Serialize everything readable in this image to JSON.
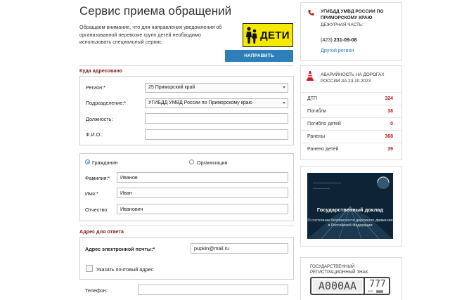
{
  "page_title": "Сервис приема обращений",
  "intro_text": "Обращаем внимание, что для направления уведомления об организованной перевозке групп детей необходимо использовать специальный сервис",
  "deti_logo": "ДЕТИ",
  "notify_button": "НАПРАВИТЬ УВЕДОМЛЕНИЕ",
  "address_section": {
    "title": "Куда адресовано",
    "region_label": "Регион:*",
    "region_value": "25 Приморский край",
    "division_label": "Подразделение:*",
    "division_value": "УГИБДД УМВД России по Приморскому краю",
    "position_label": "Должность:",
    "position_value": "",
    "fio_label": "Ф.И.О.:",
    "fio_value": ""
  },
  "applicant_section": {
    "radio_citizen": "Гражданин",
    "radio_org": "Организация",
    "lastname_label": "Фамилия:*",
    "lastname_value": "Иванов",
    "firstname_label": "Имя:*",
    "firstname_value": "Иван",
    "patronymic_label": "Отчество:",
    "patronymic_value": "Иванович"
  },
  "reply_section": {
    "title": "Адрес для ответа",
    "email_label": "Адрес электронной почты:*",
    "email_value": "pupkin@mail.ru",
    "postal_checkbox_label": "Указать почтовый адрес",
    "phone_label": "Телефон:",
    "phone_value": ""
  },
  "duty_panel": {
    "title": "УГИБДД УМВД РОССИИ ПО ПРИМОРСКОМУ КРАЮ",
    "subtitle": "ДЕЖУРНАЯ ЧАСТЬ:",
    "phone_code": "(423)",
    "phone_number": "231-09-08",
    "other_region_link": "Другой регион"
  },
  "accident_panel": {
    "title": "АВАРИЙНОСТЬ НА ДОРОГАХ РОССИИ ЗА 23.10.2023",
    "rows": [
      {
        "label": "ДТП",
        "value": "324"
      },
      {
        "label": "Погибли",
        "value": "38"
      },
      {
        "label": "Погибло детей",
        "value": "0"
      },
      {
        "label": "Ранены",
        "value": "368"
      },
      {
        "label": "Ранено детей",
        "value": "39"
      }
    ]
  },
  "report_banner": {
    "title": "Государственный доклад",
    "subtitle": "О состоянии безопасности дорожного движения в Российской Федерации"
  },
  "regplate_panel": {
    "title": "ГОСУДАРСТВЕННЫЙ РЕГИСТРАЦИОННЫЙ ЗНАК",
    "plate_number": "А000АА",
    "plate_region": "777",
    "plate_rus": "RUS"
  },
  "colors": {
    "accent_blue": "#2c7fb8",
    "section_red": "#7b1c1c",
    "stat_red": "#b02020",
    "deti_yellow": "#f6e900"
  }
}
